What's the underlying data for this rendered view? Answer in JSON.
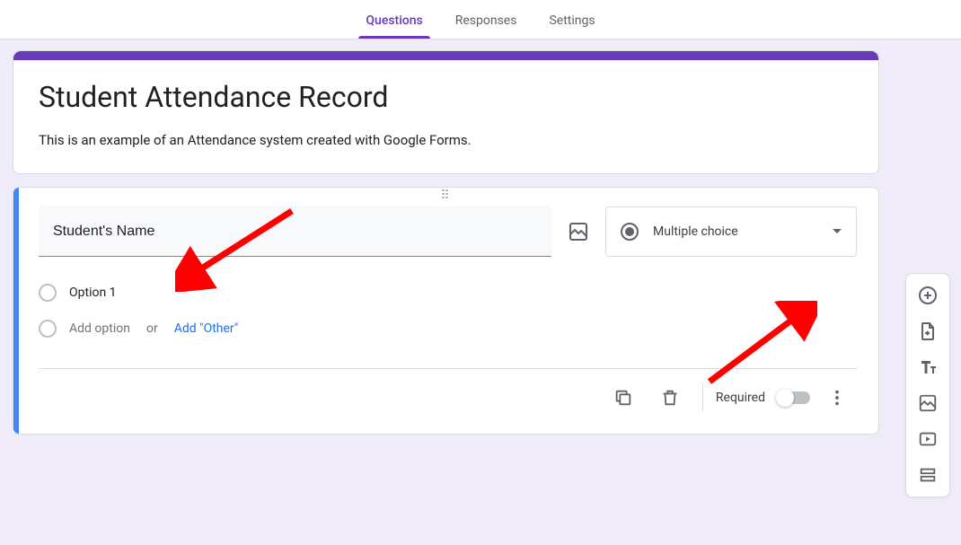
{
  "tabs": {
    "questions": "Questions",
    "responses": "Responses",
    "settings": "Settings"
  },
  "header": {
    "title": "Student Attendance Record",
    "description": "This is an example of an Attendance system created with Google Forms."
  },
  "question": {
    "title": "Student's Name",
    "type_label": "Multiple choice",
    "option1": "Option 1",
    "add_option": "Add option",
    "or": "or",
    "add_other": "Add \"Other\""
  },
  "footer": {
    "required_label": "Required"
  },
  "toolbar": {
    "add_question": "add-question-icon",
    "import": "import-questions-icon",
    "add_title": "add-title-icon",
    "add_image": "add-image-icon",
    "add_video": "add-video-icon",
    "add_section": "add-section-icon"
  },
  "colors": {
    "accent": "#673ab7",
    "active_border": "#4285f4",
    "link": "#1a73e8",
    "annotation": "#ff0000"
  }
}
